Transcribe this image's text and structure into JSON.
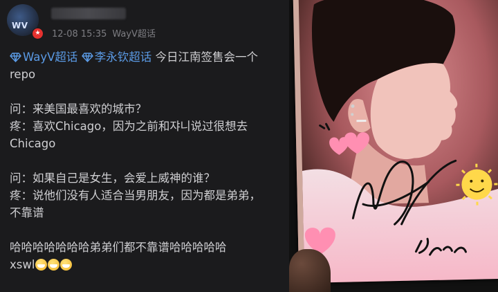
{
  "post": {
    "timestamp": "12-08 15:35",
    "source": "WayV超话",
    "tags": [
      "WayV超话",
      "李永钦超话"
    ],
    "title_rest": "今日江南签售会一个",
    "title_line2": "repo",
    "q1": "问：来美国最喜欢的城市？",
    "a1_line1": "疼：喜欢Chicago，因为之前和쟈니说过很想去",
    "a1_line2": "Chicago",
    "q2": "问：如果自己是女生，会爱上威神的谁？",
    "a2_line1": "疼：说他们没有人适合当男朋友，因为都是弟弟，",
    "a2_line2": "不靠谱",
    "closing_line1": "哈哈哈哈哈哈哈弟弟们都不靠谱哈哈哈哈哈",
    "closing_line2": "xswl"
  },
  "avatar": {
    "logo_text": "WV"
  },
  "colors": {
    "topic": "#5b9be6",
    "badge": "#e6312f",
    "heart": "#ff8fb2",
    "sun": "#ffd84a"
  }
}
